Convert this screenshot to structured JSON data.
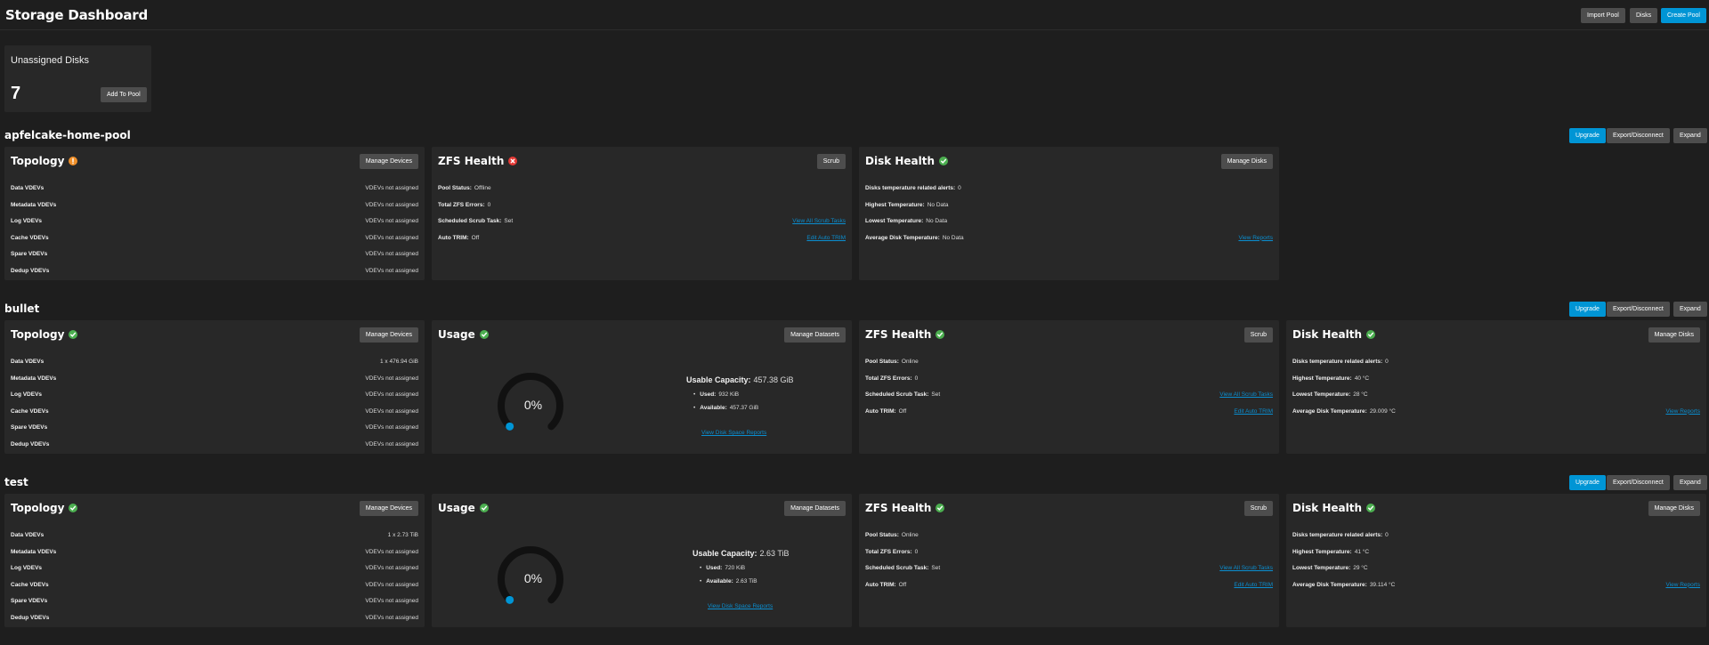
{
  "header": {
    "title": "Storage Dashboard",
    "import_pool": "Import Pool",
    "disks": "Disks",
    "create_pool": "Create Pool"
  },
  "unassigned": {
    "title": "Unassigned Disks",
    "count": "7",
    "add_to_pool": "Add To Pool"
  },
  "pool_actions": {
    "upgrade": "Upgrade",
    "export": "Export/Disconnect",
    "expand": "Expand"
  },
  "topology_labels": [
    "Data VDEVs",
    "Metadata VDEVs",
    "Log VDEVs",
    "Cache VDEVs",
    "Spare VDEVs",
    "Dedup VDEVs"
  ],
  "common": {
    "topology_title": "Topology",
    "manage_devices": "Manage Devices",
    "usage_title": "Usage",
    "manage_datasets": "Manage Datasets",
    "zfs_title": "ZFS Health",
    "scrub": "Scrub",
    "disk_title": "Disk Health",
    "manage_disks": "Manage Disks",
    "pool_status": "Pool Status:",
    "total_errors": "Total ZFS Errors:",
    "scheduled_scrub": "Scheduled Scrub Task:",
    "auto_trim": "Auto TRIM:",
    "view_scrub": "View All Scrub Tasks",
    "edit_trim": "Edit Auto TRIM",
    "disk_alerts": "Disks temperature related alerts:",
    "highest_temp": "Highest Temperature:",
    "lowest_temp": "Lowest Temperature:",
    "avg_temp": "Average Disk Temperature:",
    "view_reports": "View Reports",
    "usable_capacity": "Usable Capacity:",
    "used": "Used:",
    "available": "Available:",
    "view_disk_space": "View Disk Space Reports"
  },
  "pools": [
    {
      "name": "apfelcake-home-pool",
      "topology_status": "warning",
      "topology_values": [
        "VDEVs not assigned",
        "VDEVs not assigned",
        "VDEVs not assigned",
        "VDEVs not assigned",
        "VDEVs not assigned",
        "VDEVs not assigned"
      ],
      "zfs_status": "error",
      "pool_status": "Offline",
      "total_errors": "0",
      "scheduled_scrub": "Set",
      "auto_trim": "Off",
      "disk_alerts": "0",
      "highest_temp": "No Data",
      "lowest_temp": "No Data",
      "avg_temp": "No Data"
    },
    {
      "name": "bullet",
      "topology_status": "ok",
      "topology_values": [
        "1 x 476.94 GiB",
        "VDEVs not assigned",
        "VDEVs not assigned",
        "VDEVs not assigned",
        "VDEVs not assigned",
        "VDEVs not assigned"
      ],
      "usage_percent_label": "0%",
      "usage_fraction": 0.0,
      "usable_capacity": "457.38 GiB",
      "used": "932 KiB",
      "available": "457.37 GiB",
      "zfs_status": "ok",
      "pool_status": "Online",
      "total_errors": "0",
      "scheduled_scrub": "Set",
      "auto_trim": "Off",
      "disk_alerts": "0",
      "highest_temp": "40 °C",
      "lowest_temp": "28 °C",
      "avg_temp": "29.009 °C"
    },
    {
      "name": "test",
      "topology_status": "ok",
      "topology_values": [
        "1 x 2.73 TiB",
        "VDEVs not assigned",
        "VDEVs not assigned",
        "VDEVs not assigned",
        "VDEVs not assigned",
        "VDEVs not assigned"
      ],
      "usage_percent_label": "0%",
      "usage_fraction": 0.0,
      "usable_capacity": "2.63 TiB",
      "used": "720 KiB",
      "available": "2.63 TiB",
      "zfs_status": "ok",
      "pool_status": "Online",
      "total_errors": "0",
      "scheduled_scrub": "Set",
      "auto_trim": "Off",
      "disk_alerts": "0",
      "highest_temp": "41 °C",
      "lowest_temp": "29 °C",
      "avg_temp": "39.114 °C"
    }
  ],
  "colors": {
    "primary": "#0095d5",
    "ok": "#4caf50",
    "warning": "#f0902a",
    "error": "#e53935",
    "link": "#0a8ed0"
  }
}
